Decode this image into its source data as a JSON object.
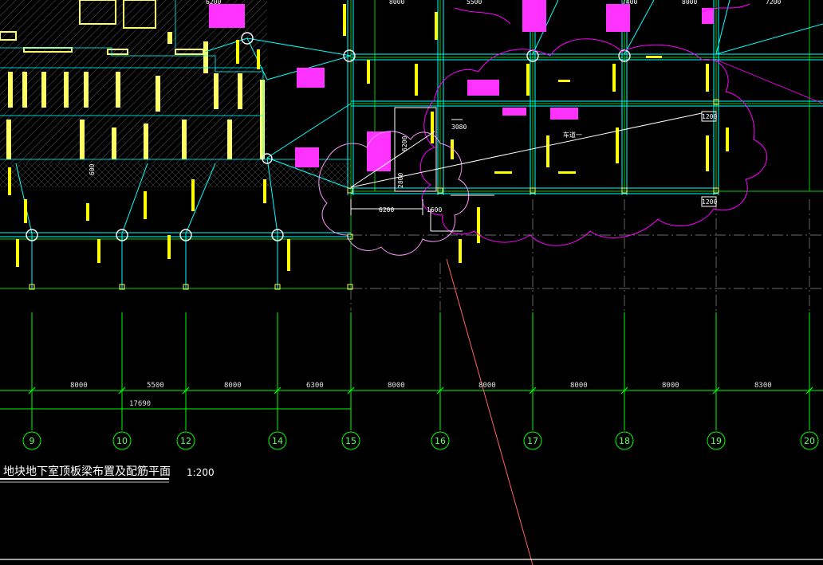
{
  "drawing": {
    "title": "地块地下室顶板梁布置及配筋平面",
    "scale": "1:200",
    "colors": {
      "background": "#000000",
      "grid": "#00ff00",
      "beam": "#00ffff",
      "column_fill": "#ffff66",
      "rebar_text": "#ffff00",
      "revision_cloud": "#ff00ff",
      "leader": "#ff6060",
      "dimension": "#ffffff"
    }
  },
  "axes": [
    {
      "label": "9"
    },
    {
      "label": "10"
    },
    {
      "label": "12"
    },
    {
      "label": "14"
    },
    {
      "label": "15"
    },
    {
      "label": "16"
    },
    {
      "label": "17"
    },
    {
      "label": "18"
    },
    {
      "label": "19"
    },
    {
      "label": "20"
    }
  ],
  "dimensions": {
    "bays": [
      "8000",
      "5500",
      "8000",
      "6300",
      "8000",
      "8000",
      "8000",
      "8000",
      "8300"
    ],
    "partial_total": "17690",
    "top_row": [
      "6200",
      "8000",
      "5500",
      "7400",
      "8000",
      "7200"
    ]
  },
  "annotations": {
    "dim_6200_v": "6200",
    "dim_6200_h": "6200",
    "dim_1600": "1600",
    "dim_3080": "3080",
    "dim_1200_a": "1200",
    "dim_1200_b": "1200",
    "dim_2800": "2800",
    "ramp_label": "车道一",
    "note_600": "600"
  }
}
